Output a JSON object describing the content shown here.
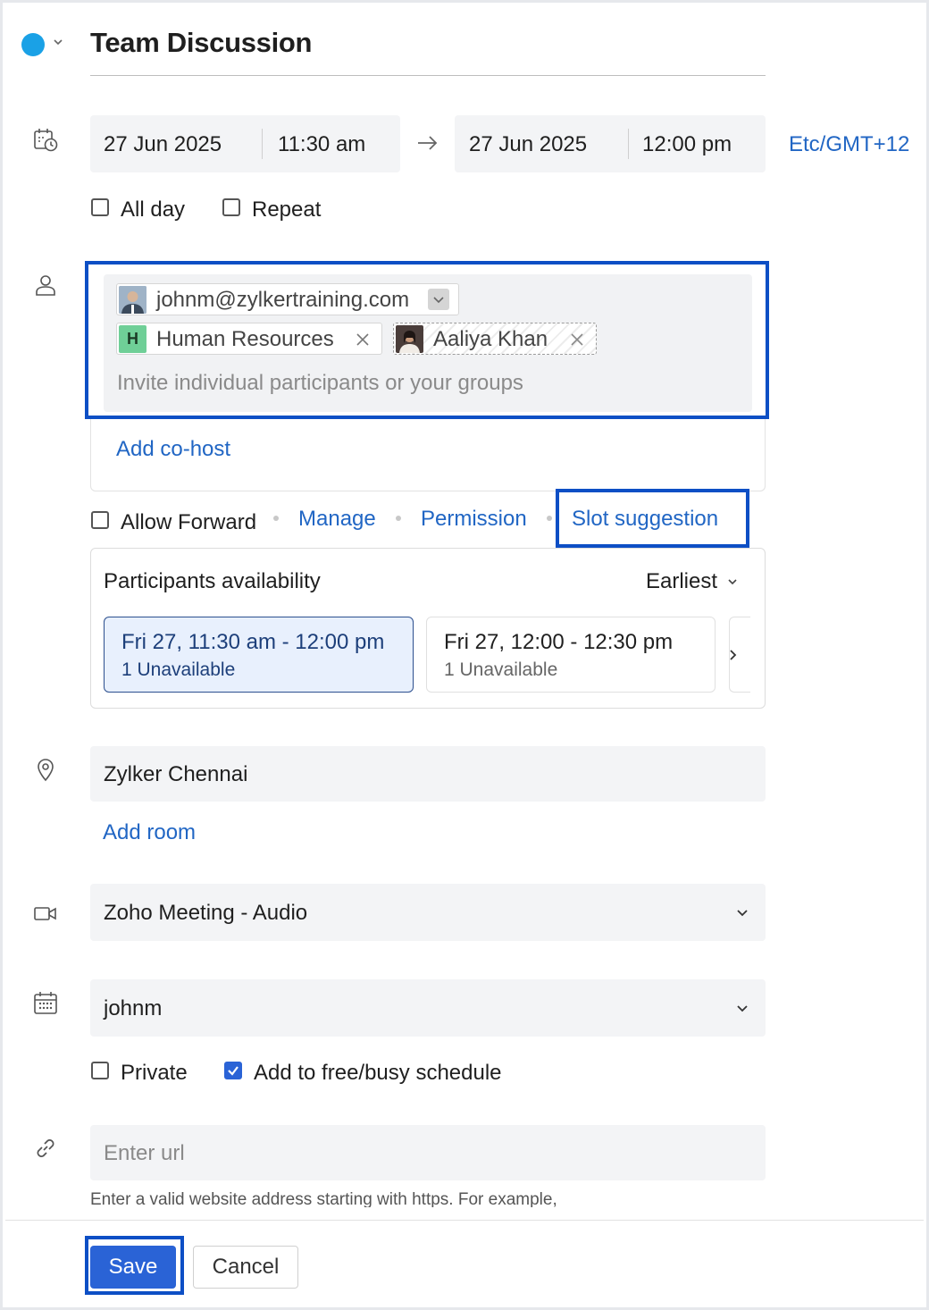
{
  "event": {
    "title": "Team Discussion",
    "color": "#1aa1e6"
  },
  "datetime": {
    "start_date": "27 Jun 2025",
    "start_time": "11:30 am",
    "end_date": "27 Jun 2025",
    "end_time": "12:00 pm",
    "timezone": "Etc/GMT+12",
    "all_day_label": "All day",
    "repeat_label": "Repeat"
  },
  "participants": {
    "chips": [
      {
        "label": "johnm@zylkertraining.com"
      },
      {
        "label": "Human Resources",
        "initial": "H"
      },
      {
        "label": "Aaliya Khan"
      }
    ],
    "placeholder": "Invite individual participants or your groups",
    "add_cohost": "Add co-host"
  },
  "options": {
    "allow_forward": "Allow Forward",
    "manage": "Manage",
    "permission": "Permission",
    "slot_suggestion": "Slot suggestion"
  },
  "availability": {
    "heading": "Participants availability",
    "sort": "Earliest",
    "slots": [
      {
        "time": "Fri 27, 11:30 am - 12:00 pm",
        "status": "1 Unavailable",
        "selected": true
      },
      {
        "time": "Fri 27, 12:00 - 12:30 pm",
        "status": "1 Unavailable",
        "selected": false
      }
    ]
  },
  "location": {
    "value": "Zylker Chennai",
    "add_room": "Add room"
  },
  "meeting": {
    "value": "Zoho Meeting - Audio"
  },
  "calendar": {
    "value": "johnm"
  },
  "visibility": {
    "private_label": "Private",
    "freebusy_label": "Add to free/busy schedule",
    "freebusy_checked": true
  },
  "url": {
    "placeholder": "Enter url",
    "hint": "Enter a valid website address starting with https. For example,"
  },
  "actions": {
    "save": "Save",
    "cancel": "Cancel"
  },
  "colors": {
    "accent": "#2a63d6",
    "link": "#2166c4",
    "highlight_frame": "#0d4fc5",
    "selected_slot_bg": "#e8f0fd"
  }
}
